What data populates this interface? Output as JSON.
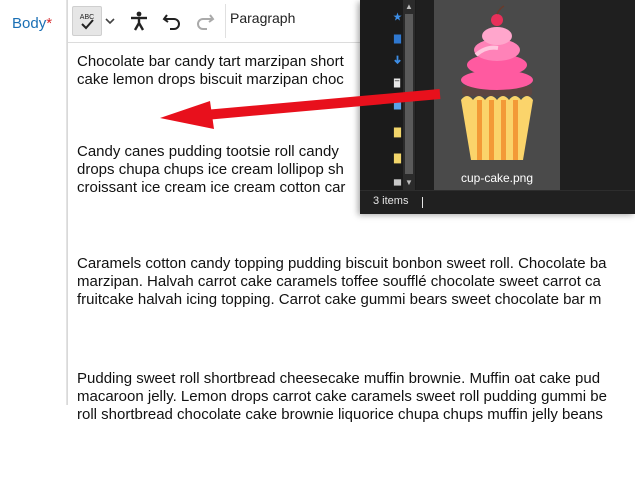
{
  "form": {
    "body_label": "Body",
    "required_mark": "*"
  },
  "toolbar": {
    "spellcheck_label": "ABC",
    "block_format": "Paragraph"
  },
  "editor": {
    "paragraphs": [
      {
        "lines": [
          "Chocolate bar candy tart marzipan short",
          "cake lemon drops biscuit marzipan choc"
        ]
      },
      {
        "lines": [
          "Candy canes pudding tootsie roll candy",
          "drops chupa chups ice cream lollipop sh",
          "croissant ice cream ice cream cotton car"
        ]
      },
      {
        "lines": [
          "Caramels cotton candy topping pudding biscuit bonbon sweet roll. Chocolate ba",
          "marzipan. Halvah carrot cake caramels toffee soufflé chocolate sweet carrot ca",
          "fruitcake halvah icing topping. Carrot cake gummi bears sweet chocolate bar m"
        ]
      },
      {
        "lines": [
          "Pudding sweet roll shortbread cheesecake muffin brownie. Muffin oat cake pud",
          "macaroon jelly. Lemon drops carrot cake caramels sweet roll pudding gummi be",
          "roll shortbread chocolate cake brownie liquorice chupa chups muffin jelly beans"
        ]
      }
    ]
  },
  "explorer": {
    "file_name": "cup-cake.png",
    "status": "3 items"
  },
  "icons": {
    "spellcheck": "spellcheck-icon",
    "dropdown": "chevron-down-icon",
    "accessibility": "accessibility-icon",
    "undo": "undo-icon",
    "redo": "redo-icon",
    "cupcake": "cupcake-image",
    "arrow": "red-arrow"
  },
  "colors": {
    "label_blue": "#1a6fb4",
    "required_red": "#d6262a",
    "arrow_red": "#e8101c",
    "explorer_bg": "#1f1f1f",
    "tile_bg": "#4a4a4a"
  }
}
